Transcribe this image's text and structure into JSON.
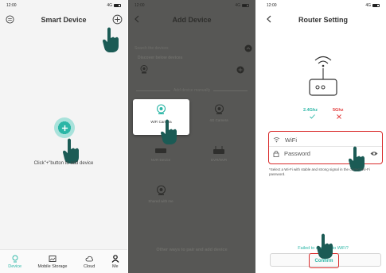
{
  "colors": {
    "accent": "#2ab6a6",
    "highlight": "#d92b2b",
    "teal_hand": "#1b5b55",
    "checkmark": "#2ab6a6",
    "cross": "#e23a3a"
  },
  "panel1": {
    "status": {
      "time": "12:00",
      "signal": "4G"
    },
    "title": "Smart Device",
    "empty_text": "Click\"+\"button to add device",
    "tabs": [
      {
        "label": "Device",
        "icon": "device-icon"
      },
      {
        "label": "Mobile Storage",
        "icon": "storage-icon"
      },
      {
        "label": "Cloud",
        "icon": "cloud-icon"
      },
      {
        "label": "Me",
        "icon": "user-icon"
      }
    ]
  },
  "panel2": {
    "status": {
      "time": "12:00",
      "signal": "4G"
    },
    "title": "Add Device",
    "search_placeholder": "Search the devices",
    "discover_label": "Discover below devices",
    "add_manually": "Add device manually",
    "devices": [
      {
        "label": "WiFi Camera",
        "icon": "wifi-camera-icon"
      },
      {
        "label": "4G Camera",
        "icon": "4g-camera-icon"
      },
      {
        "label": "NVR Device",
        "icon": "nvr-icon"
      },
      {
        "label": "DVR/NVR",
        "icon": "dvr-icon"
      },
      {
        "label": "Shared with me",
        "icon": "shared-icon"
      }
    ],
    "other_ways": "Other ways to pair and add device"
  },
  "panel3": {
    "status": {
      "time": "12:00",
      "signal": "4G"
    },
    "title": "Router Setting",
    "band1": "2.4Ghz",
    "band2": "5Ghz",
    "wifi_placeholder": "WiFi",
    "password_placeholder": "Password",
    "note": "*Select a Wi-Fi with stable and strong signal in the correct Wi-Fi password.",
    "failed_text": "Failed to connect to WiFi?",
    "confirm_label": "Confirm"
  }
}
